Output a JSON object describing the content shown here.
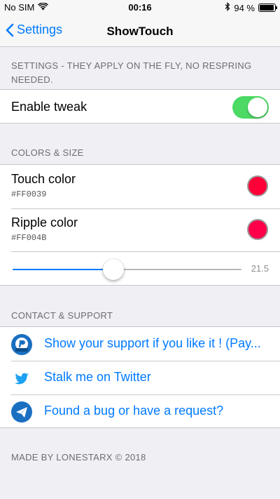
{
  "status": {
    "carrier": "No SIM",
    "time": "00:16",
    "battery": "94 %",
    "battery_level": 0.94
  },
  "nav": {
    "back_label": "Settings",
    "title": "ShowTouch"
  },
  "settings_section": {
    "header": "SETTINGS - THEY APPLY ON THE FLY, NO RESPRING NEEDED.",
    "enable_label": "Enable tweak",
    "enabled": true
  },
  "colors_section": {
    "header": "COLORS & SIZE",
    "touch_color": {
      "label": "Touch color",
      "value": "#FF0039"
    },
    "ripple_color": {
      "label": "Ripple color",
      "value": "#FF004B"
    },
    "size_slider": {
      "value": "21.5",
      "fraction": 0.44
    }
  },
  "contact_section": {
    "header": "CONTACT & SUPPORT",
    "links": [
      {
        "label": "Show your support if you like it ! (Pay...",
        "icon": "paypal-donate-icon"
      },
      {
        "label": "Stalk me on Twitter",
        "icon": "twitter-icon"
      },
      {
        "label": "Found a bug or have a request?",
        "icon": "mail-icon"
      }
    ]
  },
  "footer": "MADE BY LONESTARX © 2018",
  "colors": {
    "accent": "#007aff",
    "toggle_on": "#4cd964",
    "ios_bg": "#efeff4"
  }
}
